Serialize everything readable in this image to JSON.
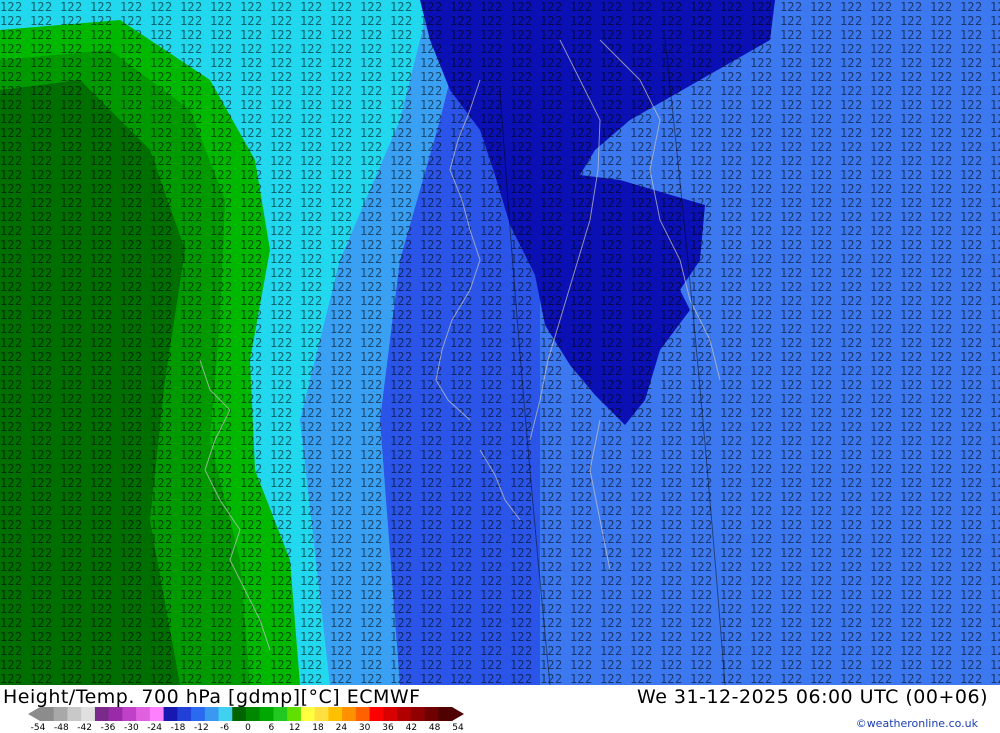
{
  "header": {
    "title": "Height/Temp. 700 hPa [gdmp][°C] ECMWF",
    "datetime": "We 31-12-2025 06:00 UTC (00+06)",
    "credit": "©weatheronline.co.uk"
  },
  "legend": {
    "ticks": [
      "-54",
      "-48",
      "-42",
      "-36",
      "-30",
      "-24",
      "-18",
      "-12",
      "-6",
      "0",
      "6",
      "12",
      "18",
      "24",
      "30",
      "36",
      "42",
      "48",
      "54"
    ],
    "colors": [
      "#8c8c8c",
      "#a8a8a8",
      "#c8c8c8",
      "#e0e0e0",
      "#7a2a8a",
      "#9a2aa8",
      "#c040c8",
      "#e060e0",
      "#ff80ff",
      "#1818b0",
      "#2040d8",
      "#2a6af0",
      "#3a98f0",
      "#40d0f0",
      "#006400",
      "#008800",
      "#00a800",
      "#20c820",
      "#60e000",
      "#ffff40",
      "#ffe040",
      "#ffc000",
      "#ff9000",
      "#ff6000",
      "#ff0000",
      "#d80000",
      "#b00000",
      "#900000",
      "#700000",
      "#500000"
    ]
  },
  "map": {
    "colors": {
      "deep_blue": "#0a10b4",
      "blue": "#2a55e8",
      "mid_blue": "#3c78f0",
      "light_blue": "#3aa0f4",
      "cyan": "#22d8ee",
      "dark_green": "#006e00",
      "green": "#009a00",
      "bright_green": "#00b800"
    }
  }
}
